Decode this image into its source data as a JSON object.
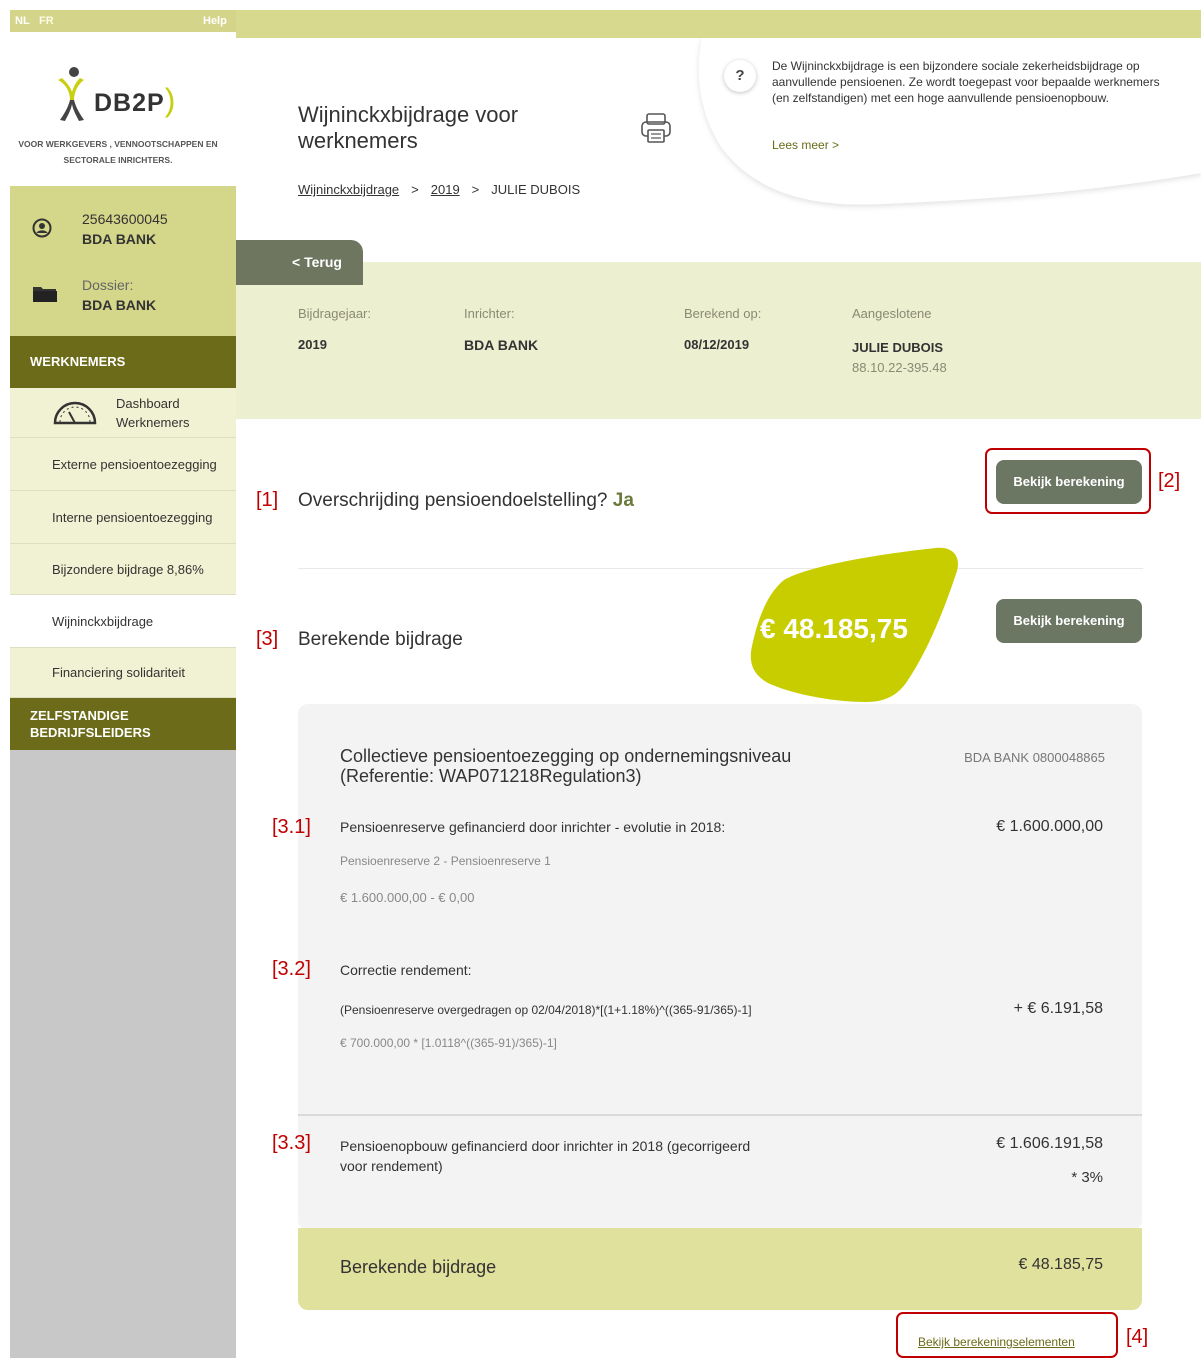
{
  "topbar": {
    "lang_nl": "NL",
    "lang_fr": "FR",
    "help": "Help"
  },
  "logo": {
    "name": "DB2P",
    "tagline_1": "VOOR WERKGEVERS , VENNOOTSCHAPPEN EN",
    "tagline_2": "SECTORALE INRICHTERS."
  },
  "account": {
    "number": "25643600045",
    "name": "BDA BANK",
    "dossier_label": "Dossier:",
    "dossier_name": "BDA BANK"
  },
  "sidebar": {
    "section_employees": "WERKNEMERS",
    "dashboard_line1": "Dashboard",
    "dashboard_line2": "Werknemers",
    "items": [
      {
        "label": "Externe pensioentoezegging"
      },
      {
        "label": "Interne pensioentoezegging"
      },
      {
        "label": "Bijzondere bijdrage 8,86%"
      },
      {
        "label": "Wijninckxbijdrage"
      },
      {
        "label": "Financiering solidariteit"
      }
    ],
    "section_self_employed_1": "ZELFSTANDIGE",
    "section_self_employed_2": "BEDRIJFSLEIDERS"
  },
  "header": {
    "title_line1": "Wijninckxbijdrage voor",
    "title_line2": "werknemers",
    "breadcrumb": {
      "root": "Wijninckxbijdrage",
      "year": "2019",
      "current": "JULIE DUBOIS",
      "sep": ">"
    }
  },
  "info": {
    "q": "?",
    "text": "De Wijninckxbijdrage is een bijzondere sociale zekerheidsbijdrage op aanvullende pensioenen. Ze wordt toegepast voor bepaalde werknemers (en zelfstandigen) met een hoge aanvullende pensioenopbouw.",
    "link": "Lees meer >"
  },
  "back": "< Terug",
  "summary": {
    "year_label": "Bijdragejaar:",
    "year": "2019",
    "organizer_label": "Inrichter:",
    "organizer": "BDA BANK",
    "calc_label": "Berekend op:",
    "calc_date": "08/12/2019",
    "member_label": "Aangeslotene",
    "member_name": "JULIE DUBOIS",
    "member_id": "88.10.22-395.48"
  },
  "markers": {
    "m1": "[1]",
    "m2": "[2]",
    "m3": "[3]",
    "m31": "[3.1]",
    "m32": "[3.2]",
    "m33": "[3.3]",
    "m4": "[4]"
  },
  "overrun": {
    "question": "Overschrijding pensioendoelstelling?",
    "answer": "Ja",
    "button": "Bekijk berekening"
  },
  "calculated": {
    "title": "Berekende bijdrage",
    "amount": "€ 48.185,75",
    "button": "Bekijk berekening"
  },
  "panel": {
    "title_line1": "Collectieve pensioentoezegging op ondernemingsniveau",
    "title_line2": "(Referentie: WAP071218Regulation3)",
    "employer": "BDA BANK 0800048865",
    "row1": {
      "label": "Pensioenreserve gefinancierd door inrichter - evolutie in 2018:",
      "amount": "€ 1.600.000,00",
      "sub1": "Pensioenreserve 2 - Pensioenreserve 1",
      "sub2": "€ 1.600.000,00 - € 0,00"
    },
    "row2": {
      "label": "Correctie rendement:",
      "formula": "(Pensioenreserve overgedragen op 02/04/2018)*[(1+1.18%)^((365-91/365)-1]",
      "amount": "+ € 6.191,58",
      "sub": "€ 700.000,00 * [1.0118^((365-91)/365)-1]"
    },
    "row3": {
      "label_line1": "Pensioenopbouw gefinancierd door inrichter in 2018 (gecorrigeerd",
      "label_line2": "voor rendement)",
      "amount": "€ 1.606.191,58",
      "factor": "* 3%"
    },
    "footer_label": "Berekende bijdrage",
    "footer_amount": "€ 48.185,75"
  },
  "view_elements": "Bekijk berekeningselementen",
  "colors": {
    "olive_dark": "#6b6b19",
    "lime": "#c8cd00",
    "khaki": "#d4d68a",
    "btn": "#6b7663",
    "red": "#c00000"
  }
}
